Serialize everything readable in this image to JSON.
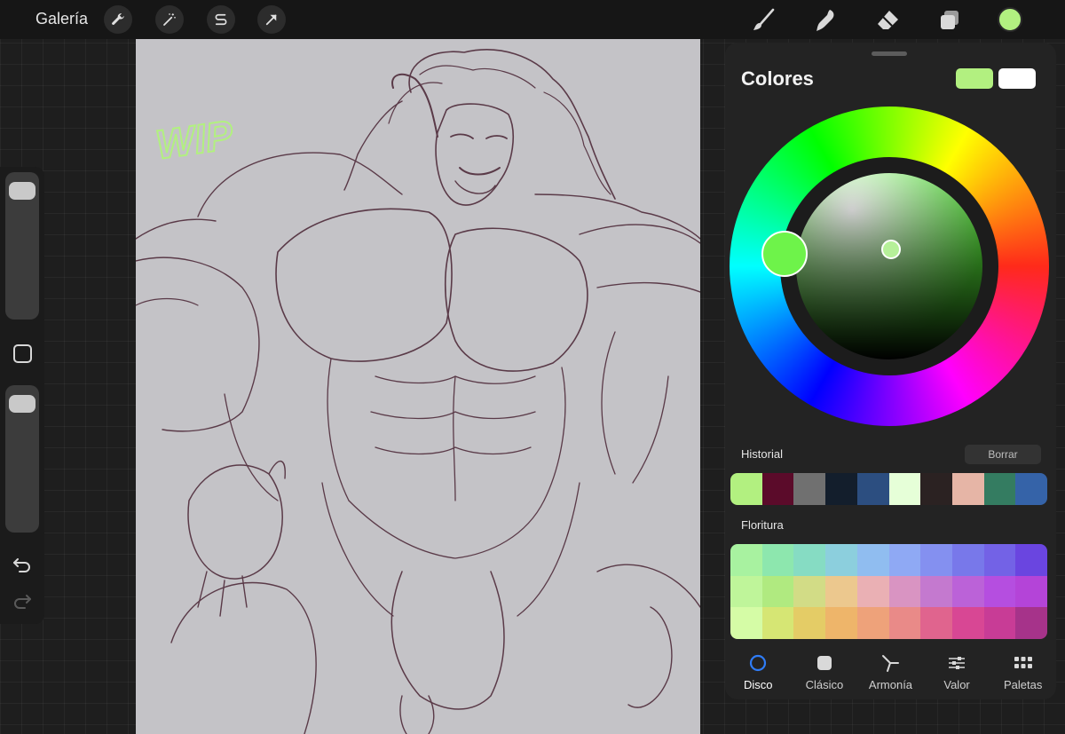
{
  "topbar": {
    "gallery_label": "Galería",
    "left_tools": [
      "wrench-icon",
      "magic-wand-icon",
      "selection-s-icon",
      "transform-arrow-icon"
    ],
    "right_tools": [
      "brush-icon",
      "smudge-icon",
      "eraser-icon",
      "layers-icon"
    ],
    "current_color": "#b2f080"
  },
  "canvas": {
    "background": "#c4c3c7",
    "wip_text": "WIP",
    "wip_color": "#b2f080",
    "stroke_color": "#5a3a48"
  },
  "sidebar": {
    "brush_size_level": 0.05,
    "opacity_level": 0.05,
    "icons": [
      "modify-square-icon",
      "undo-icon",
      "redo-icon"
    ]
  },
  "panel": {
    "title": "Colores",
    "primary_color": "#b2f080",
    "secondary_color": "#ffffff",
    "history_label": "Historial",
    "clear_label": "Borrar",
    "history_colors": [
      "#b2f080",
      "#5b0b2a",
      "#707070",
      "#131e2c",
      "#2c4e80",
      "#e6ffd8",
      "#2b2222",
      "#e6b5a6",
      "#347c61",
      "#3563a8"
    ],
    "palette_label": "Floritura",
    "palette_colors": [
      "#a8f2a0",
      "#8de7ae",
      "#86dcc3",
      "#8ccfdd",
      "#90bdf0",
      "#8fa9f4",
      "#8490f0",
      "#7878ea",
      "#7362e6",
      "#6a45e0",
      "#bff59a",
      "#b0ea80",
      "#d2dc86",
      "#ecc88e",
      "#eab0b4",
      "#d994c2",
      "#c479cf",
      "#bb62d8",
      "#b54ee0",
      "#b444d8",
      "#d5fca6",
      "#d6e674",
      "#e4cc66",
      "#eeb56a",
      "#eea27a",
      "#e98a88",
      "#e0648e",
      "#d84794",
      "#c83c96",
      "#a6338a"
    ],
    "tabs": [
      {
        "label": "Disco",
        "icon": "disc-circle-icon",
        "active": true
      },
      {
        "label": "Clásico",
        "icon": "classic-square-icon",
        "active": false
      },
      {
        "label": "Armonía",
        "icon": "harmony-icon",
        "active": false
      },
      {
        "label": "Valor",
        "icon": "sliders-icon",
        "active": false
      },
      {
        "label": "Paletas",
        "icon": "palettes-grid-icon",
        "active": false
      }
    ],
    "accent_color": "#2f7cf6"
  }
}
